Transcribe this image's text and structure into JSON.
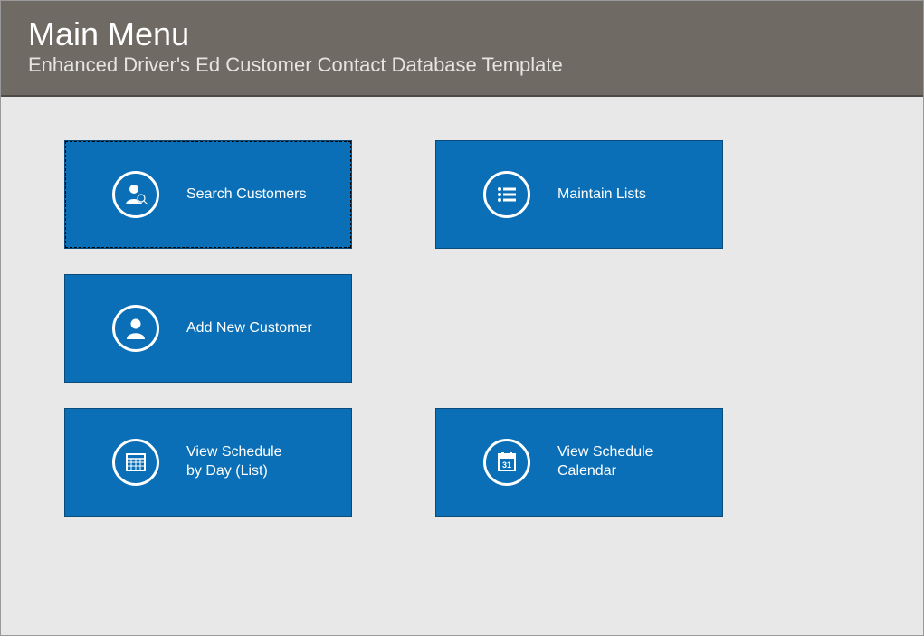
{
  "header": {
    "title": "Main Menu",
    "subtitle": "Enhanced Driver's Ed Customer Contact Database Template"
  },
  "tiles": {
    "searchCustomers": {
      "label": "Search Customers"
    },
    "maintainLists": {
      "label": "Maintain Lists"
    },
    "addNewCustomer": {
      "label": "Add New Customer"
    },
    "viewScheduleDay": {
      "label": "View Schedule\nby Day (List)"
    },
    "viewScheduleCal": {
      "label": "View Schedule\nCalendar"
    }
  }
}
